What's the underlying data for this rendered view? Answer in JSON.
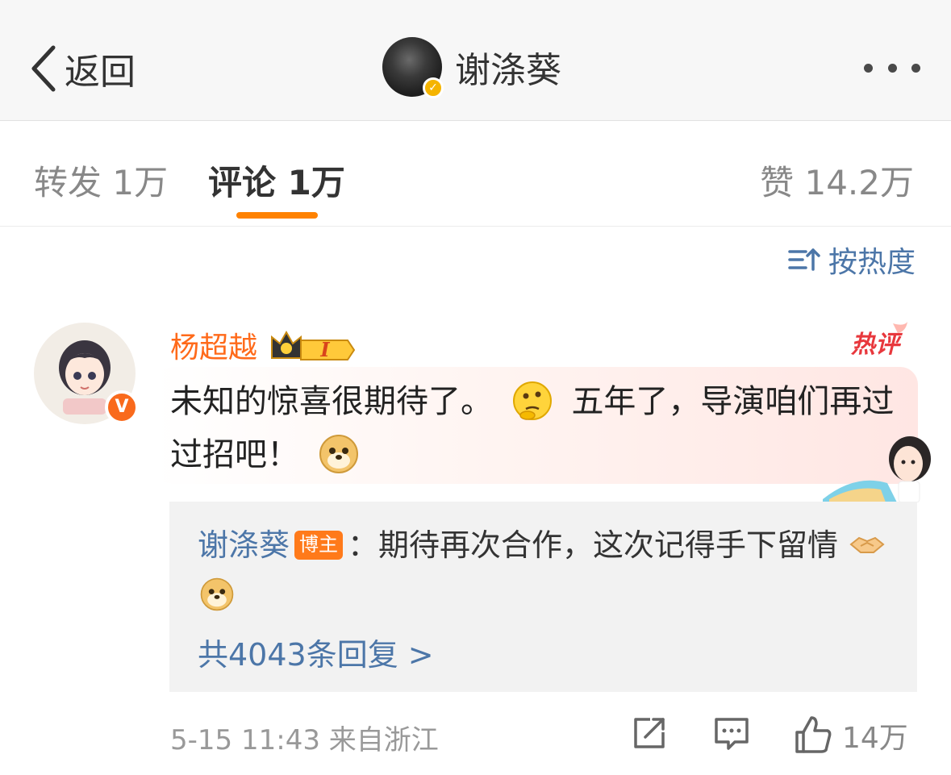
{
  "header": {
    "back_label": "返回",
    "title": "谢涤葵",
    "more_icon": "more-dots-icon"
  },
  "tabs": [
    {
      "label": "转发 1万",
      "active": false
    },
    {
      "label": "评论 1万",
      "active": true
    },
    {
      "label": "赞 14.2万",
      "active": false
    }
  ],
  "sort": {
    "label": "按热度",
    "icon": "sort-icon"
  },
  "comment": {
    "author": "杨超越",
    "level_badge": "I",
    "hot_label": "热评",
    "text_part1": "未知的惊喜很期待了。",
    "text_part2": "五年了，导演咱们再过过招吧！",
    "reply": {
      "author": "谢涤葵",
      "owner_badge": "博主",
      "text": "：期待再次合作，这次记得手下留情"
    },
    "reply_count_label": "共4043条回复 >",
    "meta": "5-15 11:43 来自浙江",
    "like_count": "14万"
  },
  "colors": {
    "accent": "#ff8200",
    "link": "#4c76a8",
    "author_vip": "#ff6a1a",
    "hot": "#e8383d"
  }
}
